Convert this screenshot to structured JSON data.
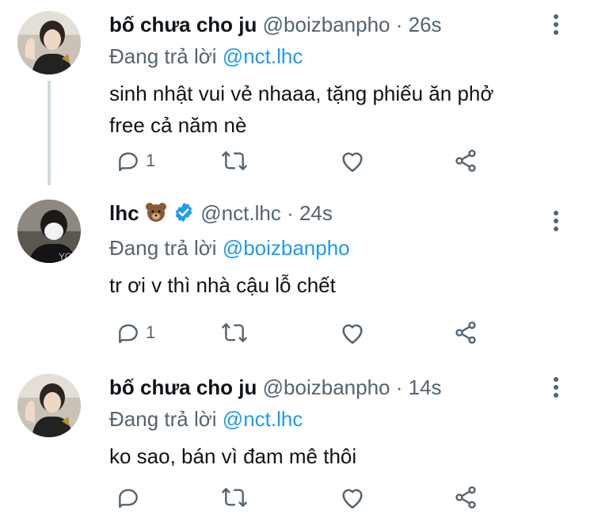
{
  "colors": {
    "link": "#1d9bf0",
    "secondary": "#536471",
    "text": "#0f1419",
    "thread_line": "#cfd9de"
  },
  "tweets": [
    {
      "name": "bố chưa cho ju",
      "handle": "@boizbanpho",
      "dot": "·",
      "time": "26s",
      "reply_prefix": "Đang trả lời",
      "reply_to": "@nct.lhc",
      "text_lines": [
        "sinh nhật vui vẻ nhaaa, tặng phiếu ăn phở",
        "free cả năm nè"
      ],
      "reply_count": "1",
      "avatar_icon": "avatar-photo-waving",
      "name_badges": []
    },
    {
      "name": "lhc",
      "handle": "@nct.lhc",
      "dot": "·",
      "time": "24s",
      "reply_prefix": "Đang trả lời",
      "reply_to": "@boizbanpho",
      "text_lines": [
        "tr ơi v thì nhà cậu lỗ chết"
      ],
      "reply_count": "1",
      "avatar_icon": "avatar-photo-masked",
      "name_badges": [
        "bear-emoji",
        "verified-badge"
      ]
    },
    {
      "name": "bố chưa cho ju",
      "handle": "@boizbanpho",
      "dot": "·",
      "time": "14s",
      "reply_prefix": "Đang trả lời",
      "reply_to": "@nct.lhc",
      "text_lines": [
        "ko sao, bán vì đam mê thôi"
      ],
      "reply_count": "",
      "avatar_icon": "avatar-photo-waving",
      "name_badges": []
    }
  ],
  "actions": {
    "icons": [
      "reply-icon",
      "retweet-icon",
      "like-icon",
      "share-icon"
    ]
  }
}
